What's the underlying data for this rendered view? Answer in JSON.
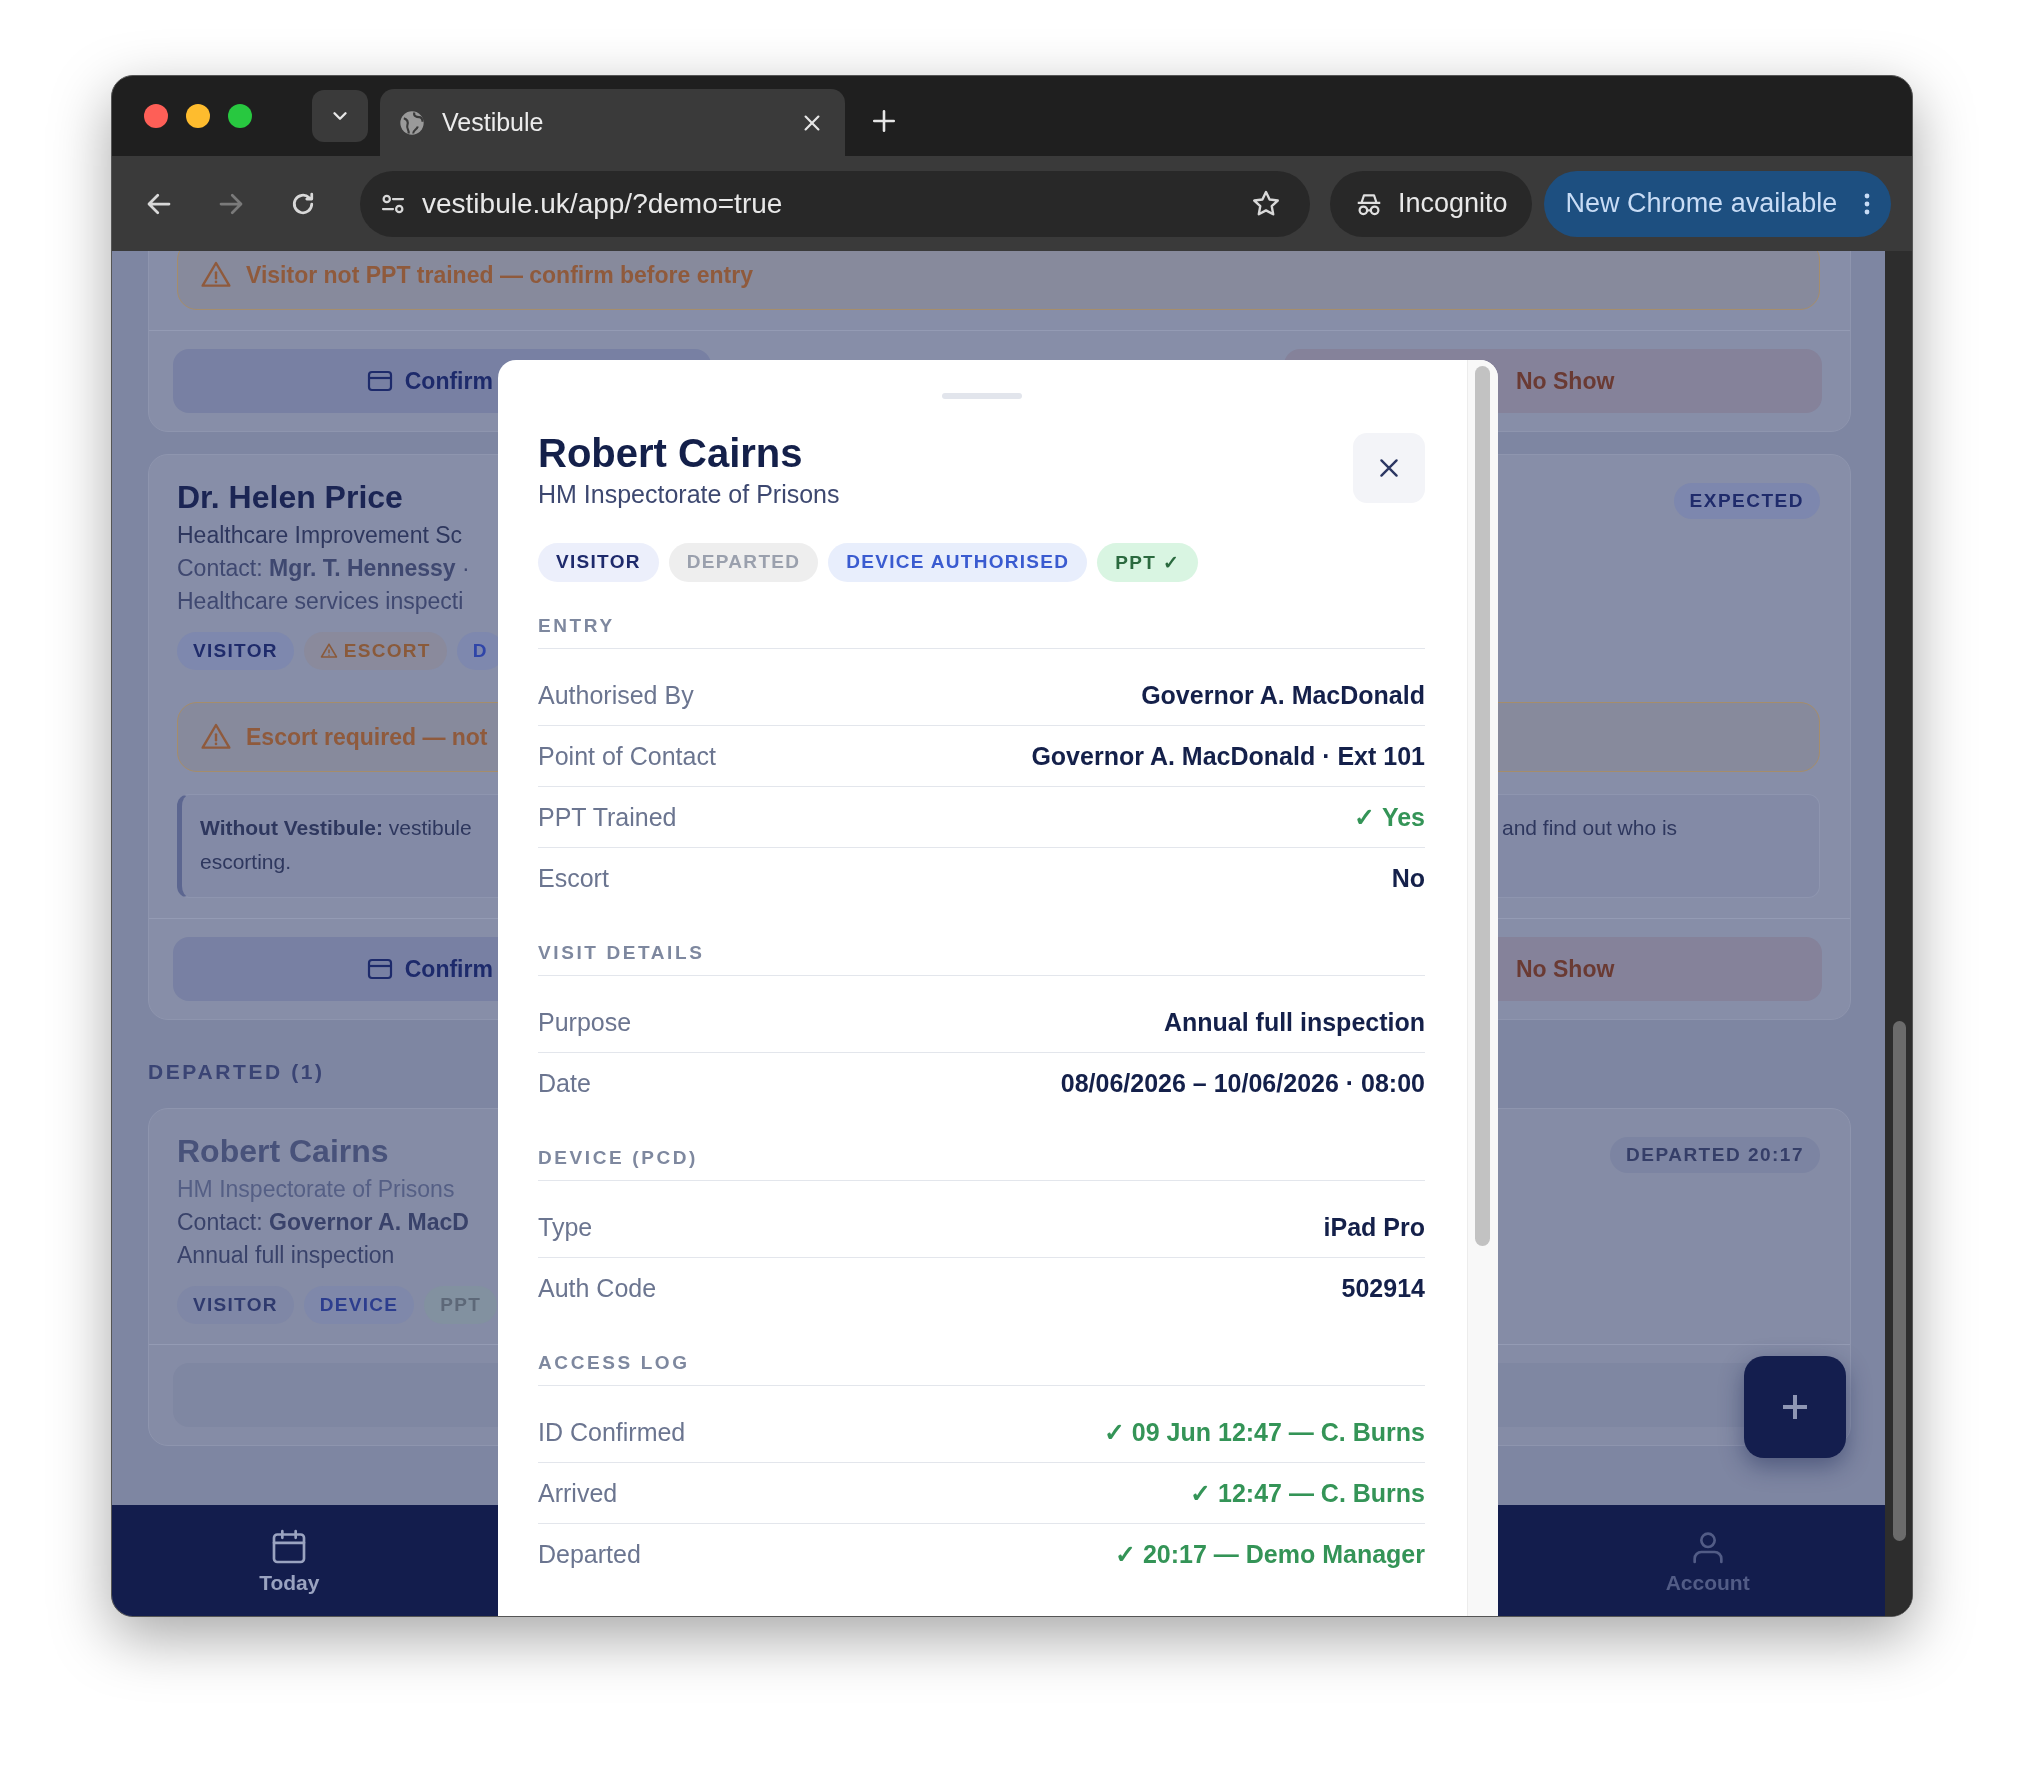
{
  "browser": {
    "tab_title": "Vestibule",
    "url": "vestibule.uk/app/?demo=true",
    "incognito_label": "Incognito",
    "update_button": "New Chrome available"
  },
  "cards": [
    {
      "warning": "Visitor not PPT trained — confirm before entry",
      "actions": [
        {
          "kind": "confirm",
          "label": "Confirm"
        },
        {
          "kind": "no_show",
          "label": "No Show"
        }
      ]
    },
    {
      "name": "Dr. Helen Price",
      "status": {
        "kind": "expected",
        "label": "EXPECTED"
      },
      "organisation": "Healthcare Improvement Sc",
      "contact": "Contact: **Mgr. T. Hennessy** ·",
      "purpose": "Healthcare services inspecti",
      "tags": [
        {
          "kind": "visitor",
          "label": "VISITOR"
        },
        {
          "kind": "escort",
          "label": "ESCORT"
        },
        {
          "kind": "device",
          "label": "D"
        }
      ],
      "warning": "Escort required — not",
      "note": {
        "left_lines": [
          "**Without Vestibule:** vestibule",
          "escorting."
        ],
        "right_lines": [
          "and find out who is"
        ]
      },
      "actions": [
        {
          "kind": "confirm",
          "label": "Confirm"
        },
        {
          "kind": "no_show",
          "label": "No Show"
        }
      ]
    }
  ],
  "departed_section": {
    "heading": "DEPARTED (1)",
    "cards": [
      {
        "name": "Robert Cairns",
        "status": {
          "kind": "departed",
          "label": "DEPARTED 20:17"
        },
        "organisation": "HM Inspectorate of Prisons",
        "contact": "Contact: **Governor A. MacD**",
        "purpose": "Annual full inspection",
        "tags": [
          {
            "kind": "visitor",
            "label": "VISITOR"
          },
          {
            "kind": "device",
            "label": "DEVICE"
          },
          {
            "kind": "ppt",
            "label": "PPT"
          }
        ],
        "actions": [
          {
            "kind": "blank"
          }
        ]
      }
    ]
  },
  "bottom_nav": [
    {
      "label": "Today",
      "selected": true
    },
    {
      "label": "Account",
      "selected": false
    }
  ],
  "detail_sheet": {
    "name": "Robert Cairns",
    "organisation": "HM Inspectorate of Prisons",
    "tags": [
      {
        "kind": "visitor",
        "label": "VISITOR"
      },
      {
        "kind": "departed",
        "label": "DEPARTED"
      },
      {
        "kind": "device",
        "label": "DEVICE AUTHORISED"
      },
      {
        "kind": "ppt",
        "label": "PPT ✓"
      }
    ],
    "sections": [
      {
        "heading": "ENTRY",
        "rows": [
          {
            "label": "Authorised By",
            "value": "Governor A. MacDonald",
            "kind": "text"
          },
          {
            "label": "Point of Contact",
            "value": "Governor A. MacDonald · **Ext 101**",
            "kind": "text"
          },
          {
            "label": "PPT Trained",
            "value": "✓ Yes",
            "kind": "ok"
          },
          {
            "label": "Escort",
            "value": "No",
            "kind": "text"
          }
        ]
      },
      {
        "heading": "VISIT DETAILS",
        "rows": [
          {
            "label": "Purpose",
            "value": "Annual full inspection",
            "kind": "text"
          },
          {
            "label": "Date",
            "value": "08/06/2026 – 10/06/2026 · 08:00",
            "kind": "text"
          }
        ]
      },
      {
        "heading": "DEVICE (PCD)",
        "rows": [
          {
            "label": "Type",
            "value": "iPad Pro",
            "kind": "text"
          },
          {
            "label": "Auth Code",
            "value": "502914",
            "kind": "text"
          }
        ]
      },
      {
        "heading": "ACCESS LOG",
        "rows": [
          {
            "label": "ID Confirmed",
            "value": "✓ 09 Jun 12:47 — C. Burns",
            "kind": "ok"
          },
          {
            "label": "Arrived",
            "value": "✓ 12:47 — C. Burns",
            "kind": "ok"
          },
          {
            "label": "Departed",
            "value": "✓ 20:17 — Demo Manager",
            "kind": "ok"
          }
        ]
      }
    ]
  }
}
